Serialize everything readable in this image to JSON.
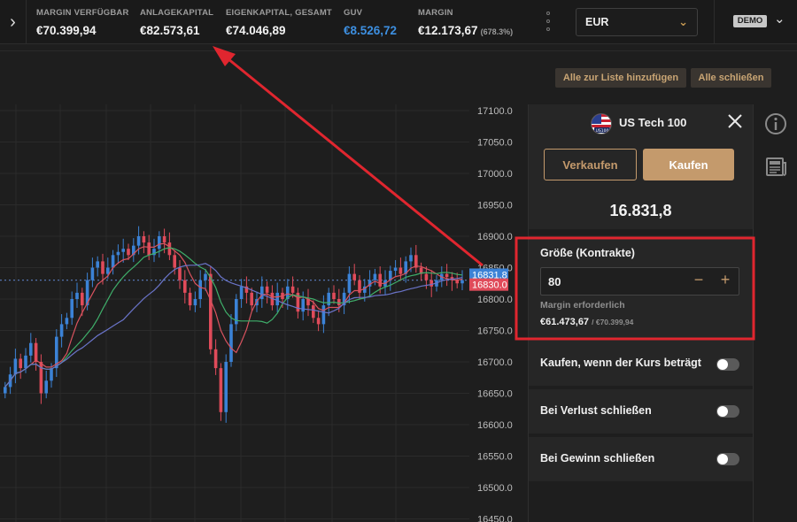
{
  "topbar": {
    "stats": [
      {
        "label": "MARGIN VERFÜGBAR",
        "value": "€70.399,94"
      },
      {
        "label": "ANLAGEKAPITAL",
        "value": "€82.573,61"
      },
      {
        "label": "EIGENKAPITAL, GESAMT",
        "value": "€74.046,89"
      },
      {
        "label": "GUV",
        "value": "€8.526,72"
      },
      {
        "label": "MARGIN",
        "value": "€12.173,67",
        "extra": "(678.3%)"
      }
    ],
    "currency": "EUR",
    "account_badge": "DEMO"
  },
  "actions": {
    "add_all_label": "Alle zur Liste hinzufügen",
    "close_all_label": "Alle schließen"
  },
  "chart": {
    "price_axis": [
      "17100.0",
      "17050.0",
      "17000.0",
      "16950.0",
      "16900.0",
      "16850.0",
      "16800.0",
      "16750.0",
      "16700.0",
      "16650.0",
      "16600.0",
      "16550.0",
      "16500.0",
      "16450.0"
    ],
    "last_price_tag": "16831.8",
    "bid_price_tag": "16830.0",
    "up_color": "#3b82d6",
    "down_color": "#e04b5a"
  },
  "chart_data": {
    "type": "line",
    "title": "",
    "ylim": [
      16450,
      17100
    ],
    "y_ticks": [
      17100,
      17050,
      17000,
      16950,
      16900,
      16850,
      16800,
      16750,
      16700,
      16650,
      16600,
      16550,
      16500,
      16450
    ],
    "last_price": 16831.8,
    "bid_price": 16830.0,
    "grid": true
  },
  "panel": {
    "instrument": "US Tech 100",
    "flag_badge": "US100",
    "sell_label": "Verkaufen",
    "buy_label": "Kaufen",
    "price": "16.831,8",
    "size_label": "Größe (Kontrakte)",
    "size_value": "80",
    "minus": "−",
    "plus": "+",
    "margin_label": "Margin erforderlich",
    "margin_value": "€61.473,67",
    "margin_avail": "/ €70.399,94",
    "options": [
      {
        "label": "Kaufen, wenn der Kurs beträgt"
      },
      {
        "label": "Bei Verlust schließen"
      },
      {
        "label": "Bei Gewinn schließen"
      }
    ]
  },
  "icons": {
    "nav": "chevron-right-icon",
    "info": "info-icon",
    "news": "news-icon",
    "close": "close-icon"
  },
  "colors": {
    "accent": "#c49a6c",
    "annotation": "#e0262f",
    "profit_blue": "#3d8fe0"
  }
}
